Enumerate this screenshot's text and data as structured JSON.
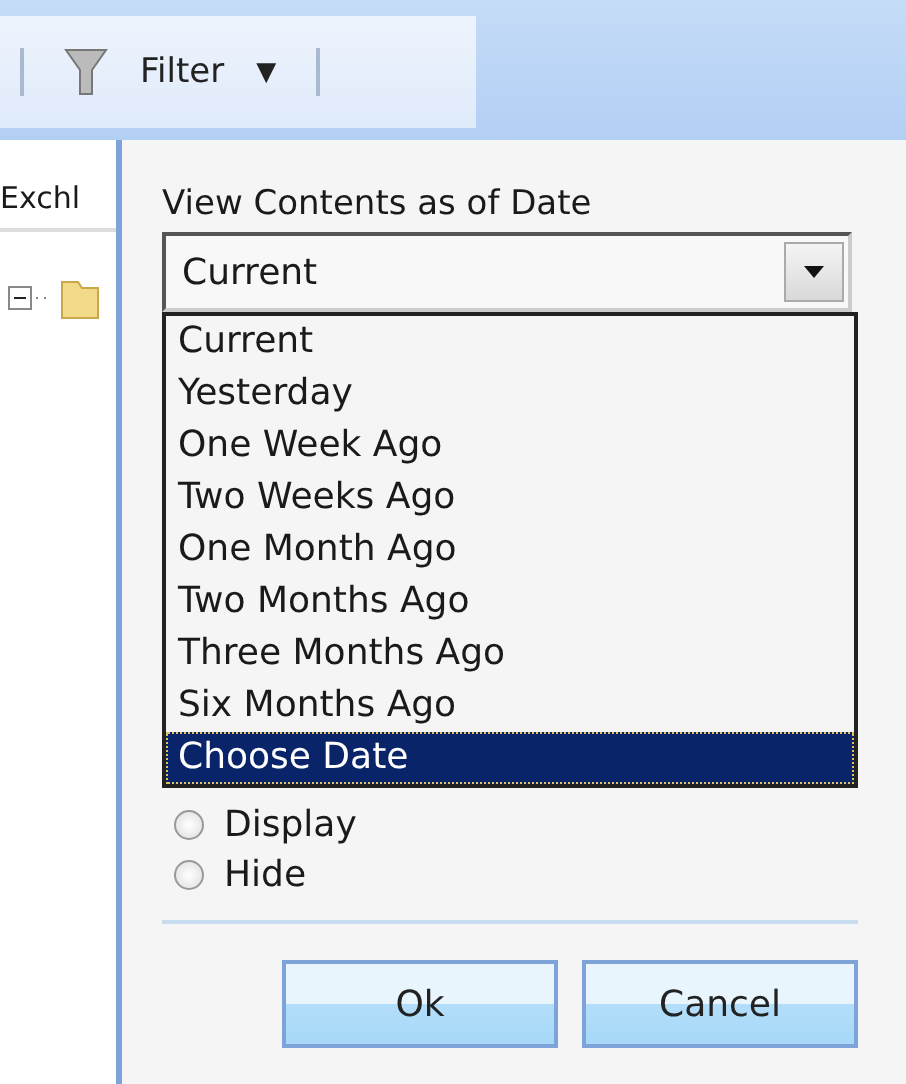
{
  "toolbar": {
    "filter_button": {
      "label": "Filter",
      "caret": "▼"
    }
  },
  "left_pane": {
    "header": "Exchl"
  },
  "dialog": {
    "field_label": "View Contents as of Date",
    "date_combo": {
      "value": "Current",
      "expanded": true
    },
    "options": [
      {
        "label": "Current",
        "selected": false
      },
      {
        "label": "Yesterday",
        "selected": false
      },
      {
        "label": "One Week Ago",
        "selected": false
      },
      {
        "label": "Two Weeks Ago",
        "selected": false
      },
      {
        "label": "One Month Ago",
        "selected": false
      },
      {
        "label": "Two Months Ago",
        "selected": false
      },
      {
        "label": "Three Months Ago",
        "selected": false
      },
      {
        "label": "Six Months Ago",
        "selected": false
      },
      {
        "label": "Choose Date",
        "selected": true
      }
    ],
    "radios": [
      {
        "label": "Display",
        "selected": false
      },
      {
        "label": "Hide",
        "selected": false
      }
    ],
    "buttons": [
      "Ok",
      "Cancel"
    ]
  }
}
